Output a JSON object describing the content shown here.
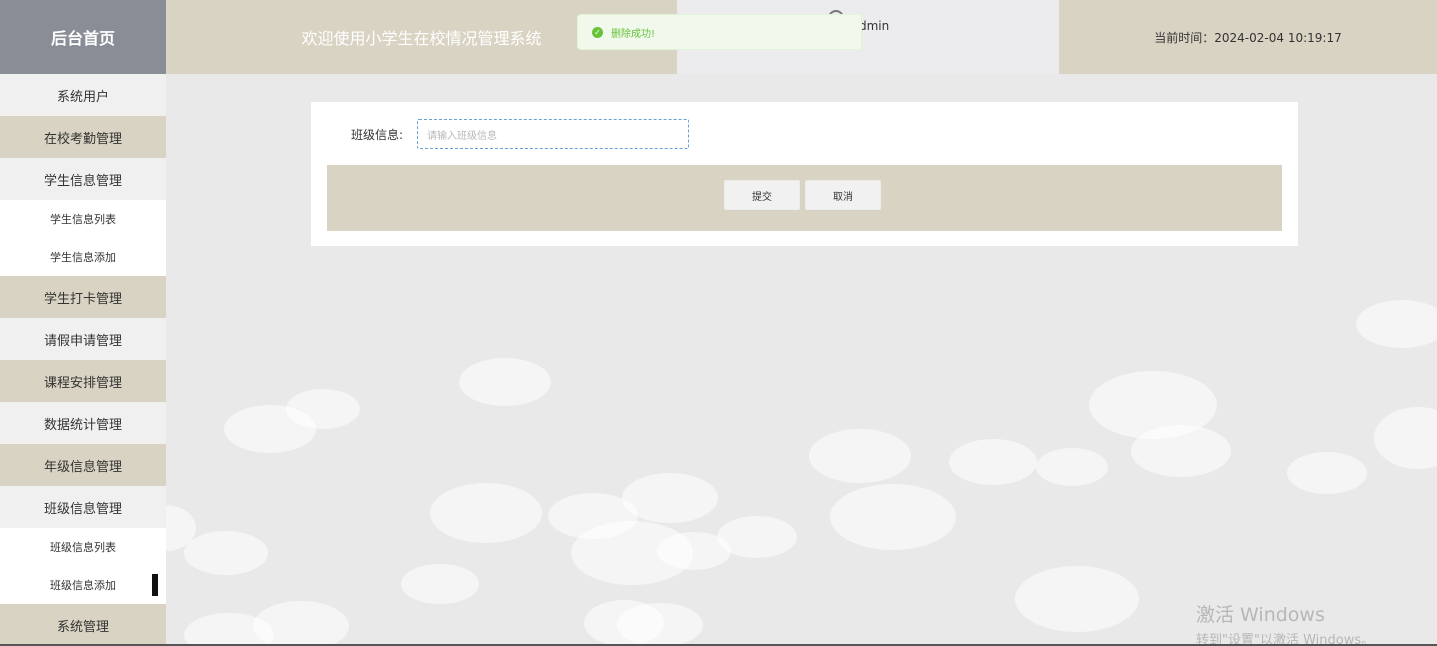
{
  "sidebar": {
    "brand": "后台首页",
    "items": [
      {
        "label": "系统用户",
        "style": "light"
      },
      {
        "label": "在校考勤管理",
        "style": "tan"
      },
      {
        "label": "学生信息管理",
        "style": "light"
      },
      {
        "label": "学生信息列表",
        "style": "sub"
      },
      {
        "label": "学生信息添加",
        "style": "sub"
      },
      {
        "label": "学生打卡管理",
        "style": "tan"
      },
      {
        "label": "请假申请管理",
        "style": "light"
      },
      {
        "label": "课程安排管理",
        "style": "tan"
      },
      {
        "label": "数据统计管理",
        "style": "light"
      },
      {
        "label": "年级信息管理",
        "style": "tan"
      },
      {
        "label": "班级信息管理",
        "style": "light"
      },
      {
        "label": "班级信息列表",
        "style": "sub"
      },
      {
        "label": "班级信息添加",
        "style": "sub"
      },
      {
        "label": "系统管理",
        "style": "tan"
      }
    ]
  },
  "header": {
    "title": "欢迎使用小学生在校情况管理系统",
    "user": "dmin",
    "time_label": "当前时间：2024-02-04 10:19:17"
  },
  "toast": {
    "message": "删除成功!",
    "icon": "check-circle-icon",
    "color": "#67c23a"
  },
  "form": {
    "label": "班级信息:",
    "placeholder": "请输入班级信息",
    "value": "",
    "submit_label": "提交",
    "cancel_label": "取消"
  },
  "watermark": {
    "title": "激活 Windows",
    "subtitle": "转到\"设置\"以激活 Windows。"
  },
  "colors": {
    "tan": "#d9d3c3",
    "brand": "#898d96",
    "success": "#67c23a"
  }
}
